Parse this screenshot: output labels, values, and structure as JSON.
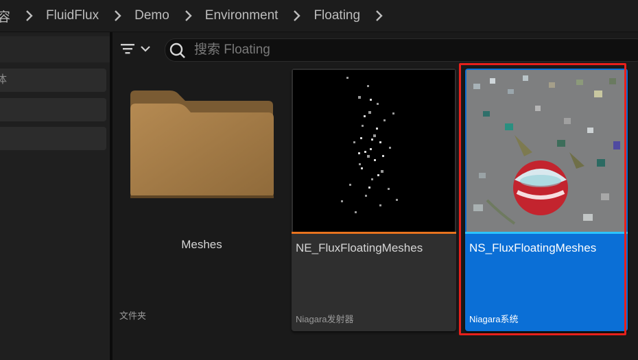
{
  "breadcrumb": {
    "items": [
      "容",
      "FluidFlux",
      "Demo",
      "Environment",
      "Floating"
    ]
  },
  "left_panel": {
    "items": [
      {
        "label": "体"
      },
      {
        "label": ""
      },
      {
        "label": ""
      }
    ]
  },
  "toolbar": {
    "filter_icon": "filter-lines-icon",
    "search": {
      "placeholder": "搜索 Floating",
      "value": ""
    }
  },
  "assets": [
    {
      "name": "Meshes",
      "type": "文件夹",
      "icon": "folder-icon"
    },
    {
      "name": "NE_FluxFloatingMeshes",
      "type": "Niagara发射器",
      "accent": "#e8731e"
    },
    {
      "name": "NS_FluxFloatingMeshes",
      "type": "Niagara系统",
      "accent": "#2cc3ff",
      "selected": true
    }
  ],
  "colors": {
    "selection": "#0b6fd6",
    "highlight_box": "#e8201b",
    "folder": "#a27b48"
  }
}
